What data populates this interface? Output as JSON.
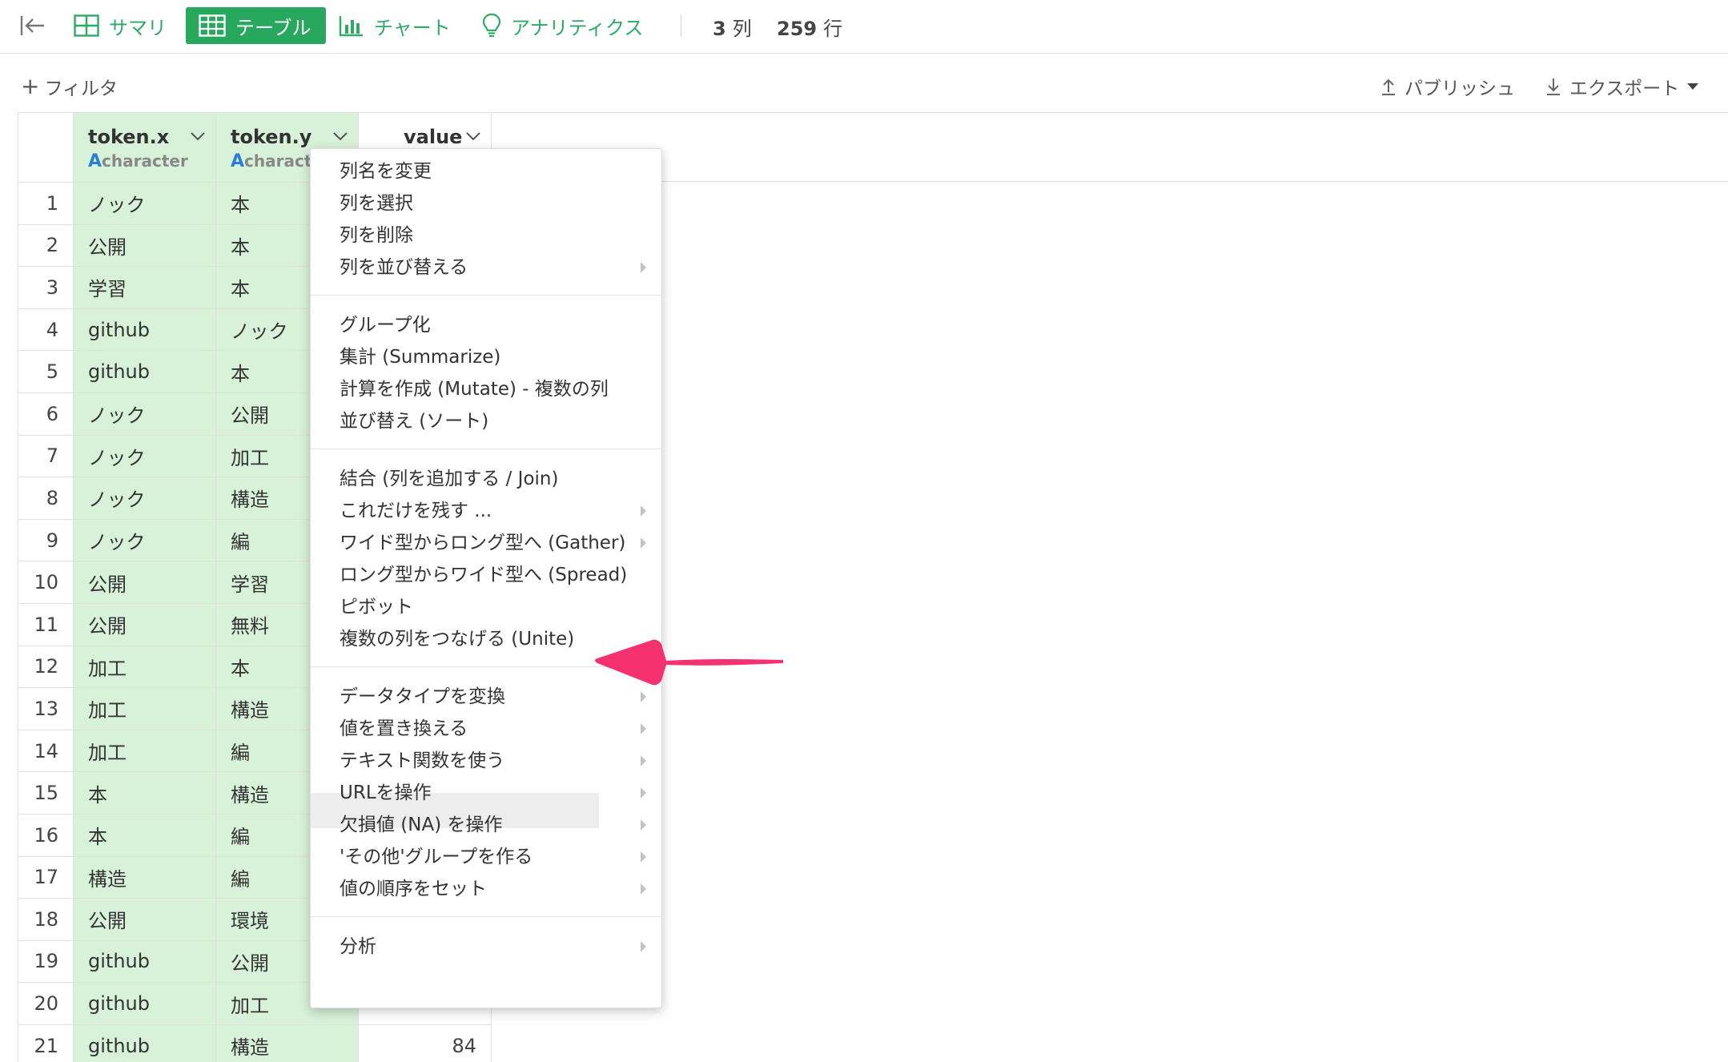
{
  "toolbar": {
    "tabs": [
      {
        "label": "サマリ",
        "icon": "summary-grid-icon",
        "active": false
      },
      {
        "label": "テーブル",
        "icon": "table-icon",
        "active": true
      },
      {
        "label": "チャート",
        "icon": "bar-chart-icon",
        "active": false
      },
      {
        "label": "アナリティクス",
        "icon": "lightbulb-icon",
        "active": false
      }
    ],
    "columns_count": "3",
    "columns_unit": "列",
    "rows_count": "259",
    "rows_unit": "行"
  },
  "filterbar": {
    "add_filter": "フィルタ",
    "publish": "パブリッシュ",
    "export": "エクスポート"
  },
  "table": {
    "columns": [
      {
        "name": "token.x",
        "type": "character",
        "type_icon": "A"
      },
      {
        "name": "token.y",
        "type": "character",
        "type_icon": "A"
      },
      {
        "name": "value"
      }
    ],
    "rows": [
      {
        "n": "1",
        "x": "ノック",
        "y": "本",
        "v": ""
      },
      {
        "n": "2",
        "x": "公開",
        "y": "本",
        "v": ""
      },
      {
        "n": "3",
        "x": "学習",
        "y": "本",
        "v": ""
      },
      {
        "n": "4",
        "x": "github",
        "y": "ノック",
        "v": ""
      },
      {
        "n": "5",
        "x": "github",
        "y": "本",
        "v": ""
      },
      {
        "n": "6",
        "x": "ノック",
        "y": "公開",
        "v": ""
      },
      {
        "n": "7",
        "x": "ノック",
        "y": "加工",
        "v": ""
      },
      {
        "n": "8",
        "x": "ノック",
        "y": "構造",
        "v": ""
      },
      {
        "n": "9",
        "x": "ノック",
        "y": "編",
        "v": ""
      },
      {
        "n": "10",
        "x": "公開",
        "y": "学習",
        "v": ""
      },
      {
        "n": "11",
        "x": "公開",
        "y": "無料",
        "v": ""
      },
      {
        "n": "12",
        "x": "加工",
        "y": "本",
        "v": ""
      },
      {
        "n": "13",
        "x": "加工",
        "y": "構造",
        "v": ""
      },
      {
        "n": "14",
        "x": "加工",
        "y": "編",
        "v": ""
      },
      {
        "n": "15",
        "x": "本",
        "y": "構造",
        "v": ""
      },
      {
        "n": "16",
        "x": "本",
        "y": "編",
        "v": ""
      },
      {
        "n": "17",
        "x": "構造",
        "y": "編",
        "v": ""
      },
      {
        "n": "18",
        "x": "公開",
        "y": "環境",
        "v": ""
      },
      {
        "n": "19",
        "x": "github",
        "y": "公開",
        "v": ""
      },
      {
        "n": "20",
        "x": "github",
        "y": "加工",
        "v": ""
      },
      {
        "n": "21",
        "x": "github",
        "y": "構造",
        "v": "84"
      }
    ]
  },
  "menu": {
    "groups": [
      [
        {
          "label": "列名を変更",
          "submenu": false
        },
        {
          "label": "列を選択",
          "submenu": false
        },
        {
          "label": "列を削除",
          "submenu": false
        },
        {
          "label": "列を並び替える",
          "submenu": true
        }
      ],
      [
        {
          "label": "グループ化",
          "submenu": false
        },
        {
          "label": "集計 (Summarize)",
          "submenu": false
        },
        {
          "label": "計算を作成 (Mutate) - 複数の列",
          "submenu": false
        },
        {
          "label": "並び替え (ソート)",
          "submenu": false
        }
      ],
      [
        {
          "label": "結合 (列を追加する / Join)",
          "submenu": false
        },
        {
          "label": "これだけを残す ...",
          "submenu": true
        },
        {
          "label": "ワイド型からロング型へ (Gather)",
          "submenu": true
        },
        {
          "label": "ロング型からワイド型へ (Spread)",
          "submenu": false
        },
        {
          "label": "ピボット",
          "submenu": false
        },
        {
          "label": "複数の列をつなげる (Unite)",
          "submenu": false,
          "highlighted": true
        }
      ],
      [
        {
          "label": "データタイプを変換",
          "submenu": true
        },
        {
          "label": "値を置き換える",
          "submenu": true
        },
        {
          "label": "テキスト関数を使う",
          "submenu": true
        },
        {
          "label": "URLを操作",
          "submenu": true
        },
        {
          "label": "欠損値 (NA) を操作",
          "submenu": true
        },
        {
          "label": "'その他'グループを作る",
          "submenu": true
        },
        {
          "label": "値の順序をセット",
          "submenu": true
        }
      ],
      [
        {
          "label": "分析",
          "submenu": true
        }
      ]
    ]
  },
  "colors": {
    "accent": "#27a85e",
    "green_column": "#d8f1d9",
    "pointer_arrow": "#f5316f",
    "type_icon": "#2a7ed6"
  }
}
